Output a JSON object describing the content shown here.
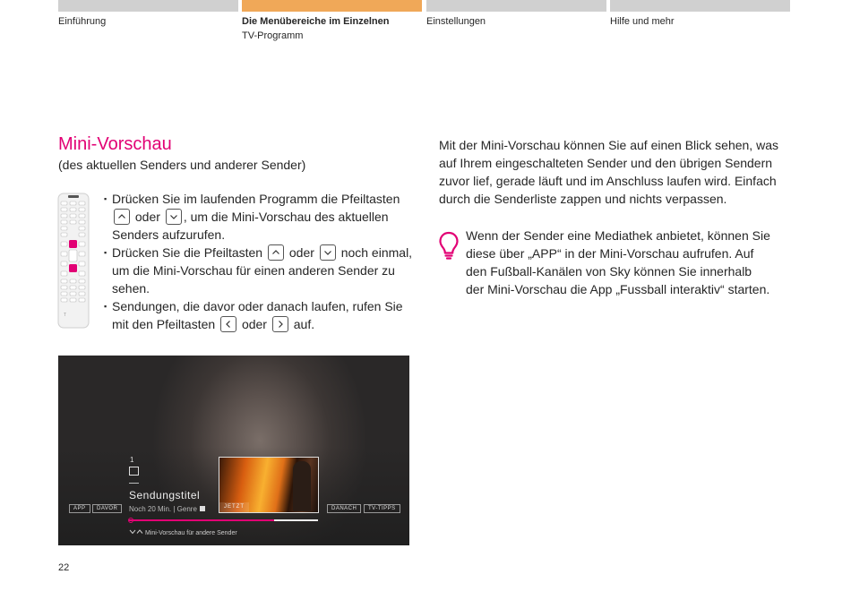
{
  "nav": {
    "tabs": [
      {
        "label": "Einführung",
        "sub": "",
        "active": false
      },
      {
        "label": "Die Menübereiche im Einzelnen",
        "sub": "TV-Programm",
        "active": true
      },
      {
        "label": "Einstellungen",
        "sub": "",
        "active": false
      },
      {
        "label": "Hilfe und mehr",
        "sub": "",
        "active": false
      }
    ],
    "colors": {
      "active": "#f0a858",
      "inactive": "#d0d0d0"
    }
  },
  "heading": {
    "title": "Mini-Vorschau",
    "subtitle": "(des aktuellen Senders und anderer Sender)",
    "color": "#e20074"
  },
  "bullets": {
    "b1": {
      "t1": "Drücken Sie im laufenden Programm die Pfeiltasten",
      "t2": "oder",
      "t3": ", um die Mini-Vorschau des aktuellen Senders aufzurufen."
    },
    "b2": {
      "t1": "Drücken Sie die Pfeiltasten",
      "t2": "oder",
      "t3": "noch einmal, um die Mini-Vorschau für einen anderen Sender zu sehen."
    },
    "b3": {
      "t1": "Sendungen, die davor oder danach laufen, rufen Sie mit den Pfeiltasten",
      "t2": "oder",
      "t3": "auf."
    }
  },
  "icons": {
    "remote": "remote-control-icon",
    "up": "chevron-up-icon",
    "down": "chevron-down-icon",
    "left": "chevron-left-icon",
    "right": "chevron-right-icon",
    "tip": "lightbulb-icon"
  },
  "description": "Mit der Mini-Vorschau können Sie auf einen Blick sehen, was auf Ihrem eingeschalteten Sender und den übrigen Sendern zuvor lief, gerade läuft und im Anschluss laufen wird. Einfach durch die Senderliste zappen und nichts verpassen.",
  "tip": "Wenn der Sender eine Mediathek anbietet, können Sie diese über „APP“ in der Mini-Vorschau aufrufen. Auf den Fußball-Kanälen von Sky können Sie innerhalb der Mini-Vorschau die App „Fussball interaktiv“ starten.",
  "tv": {
    "channel_number": "1",
    "show_title": "Sendungstitel",
    "show_meta": "Noch 20 Min. | Genre",
    "buttons": {
      "app": "APP",
      "davor": "DAVOR",
      "danach": "DANACH",
      "tips": "TV-TIPPS"
    },
    "preview_label": "JETZT",
    "hint": "Mini-Vorschau für andere Sender",
    "progress": 0.77
  },
  "page_number": "22"
}
